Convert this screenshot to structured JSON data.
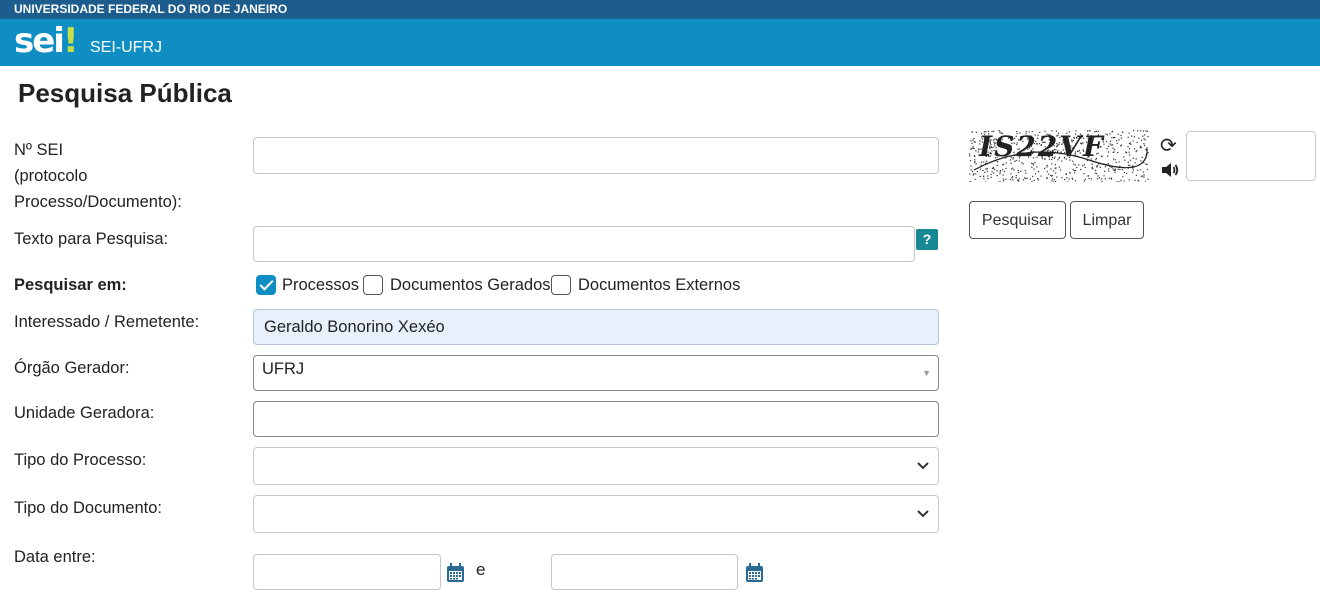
{
  "topbar": {
    "institution": "UNIVERSIDADE FEDERAL DO RIO DE JANEIRO"
  },
  "header": {
    "logo_text": "sei",
    "logo_dot": "!",
    "site_name": "SEI-UFRJ"
  },
  "page": {
    "title": "Pesquisa Pública"
  },
  "form": {
    "nsei_label_1": "Nº SEI",
    "nsei_label_2": "(protocolo",
    "nsei_label_3": "Processo/Documento):",
    "nsei_value": "",
    "texto_label": "Texto para Pesquisa:",
    "texto_value": "",
    "help_symbol": "?",
    "pesquisar_em_label": "Pesquisar em:",
    "checks": {
      "processos": {
        "label": "Processos",
        "checked": true
      },
      "documentos_gerados": {
        "label": "Documentos Gerados",
        "checked": false
      },
      "documentos_externos": {
        "label": "Documentos Externos",
        "checked": false
      }
    },
    "interessado_label": "Interessado / Remetente:",
    "interessado_value": "Geraldo Bonorino Xexéo",
    "orgao_label": "Órgão Gerador:",
    "orgao_value": "UFRJ",
    "unidade_label": "Unidade Geradora:",
    "unidade_value": "",
    "tipo_processo_label": "Tipo do Processo:",
    "tipo_processo_value": "",
    "tipo_documento_label": "Tipo do Documento:",
    "tipo_documento_value": "",
    "data_label": "Data entre:",
    "data_connector": "e",
    "data_inicio": "",
    "data_fim": ""
  },
  "captcha": {
    "image_text": "IS22VF",
    "refresh_icon": "refresh-icon",
    "audio_icon": "speaker-icon",
    "input_value": ""
  },
  "buttons": {
    "search": "Pesquisar",
    "clear": "Limpar"
  },
  "colors": {
    "topbar": "#1d5d8d",
    "header": "#0f8ec4",
    "accent": "#178894",
    "logo_dot": "#c6e04b"
  }
}
